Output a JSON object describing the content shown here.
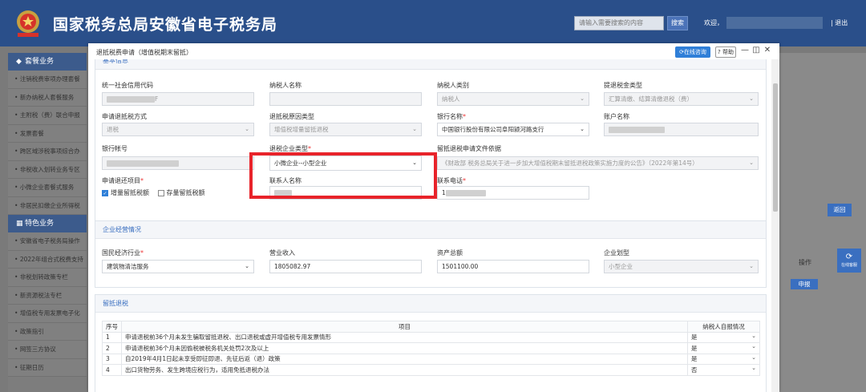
{
  "header": {
    "site_title": "国家税务总局安徽省电子税务局",
    "search_placeholder": "请输入需要搜索的内容",
    "search_button": "搜索",
    "welcome": "欢迎，",
    "logout": "| 退出"
  },
  "sidebar": {
    "section1": "套餐业务",
    "items1": [
      "注销税费审项办理套餐",
      "新办纳税人套餐服务",
      "主附税（费）联合申报",
      "发票套餐",
      "跨区域涉税事项综合办",
      "非税收入划转业务专区",
      "小微企业套餐式服务",
      "非居民扣缴企业所得税"
    ],
    "section2": "特色业务",
    "items2": [
      "安徽省电子税务局操作",
      "2022年组合式税费支持",
      "非税划转政策专栏",
      "新资源税法专栏",
      "增值税专用发票电子化",
      "政策指引",
      "网签三方协议",
      "征期日历"
    ]
  },
  "backdrop": {
    "return": "返回",
    "operation": "操作",
    "declare": "申报",
    "online": "在线客服"
  },
  "modal": {
    "title": "退抵税费申请（增值税期末留抵）",
    "online_consult": "在线咨询",
    "help": "帮助",
    "basic_section": "基本信息",
    "fields": {
      "credit_code_label": "统一社会信用代码",
      "credit_code_value": "F",
      "taxpayer_name_label": "纳税人名称",
      "taxpayer_type_label": "纳税人类别",
      "taxpayer_type_value": "纳税人",
      "refund_type_label": "提退税金类型",
      "refund_type_value": "汇算清缴、结算清缴退税（费）",
      "method_label": "申请退抵税方式",
      "method_value": "退税",
      "reason_label": "退抵税原因类型",
      "reason_value": "增值税增量留抵退税",
      "bank_name_label": "银行名称",
      "bank_name_value": "中国银行股份有限公司阜阳颍河路支行",
      "account_name_label": "账户名称",
      "account_no_label": "银行帐号",
      "enterprise_type_label": "退税企业类型",
      "enterprise_type_value": "小微企业--小型企业",
      "basis_label": "留抵退税申请文件依据",
      "basis_value": "《财政部 税务总局关于进一步加大增值税期末留抵退税政策实施力度的公告》（2022年第14号）",
      "refund_item_label": "申请退还项目",
      "refund_item_opt1": "增量留抵税额",
      "refund_item_opt2": "存量留抵税额",
      "contact_label": "联系人名称",
      "phone_label": "联系电话",
      "phone_value": "1"
    },
    "ops_section": "企业经营情况",
    "ops": {
      "industry_label": "国民经济行业",
      "industry_value": "建筑物清洁服务",
      "revenue_label": "营业收入",
      "revenue_value": "1805082.97",
      "assets_label": "资产总额",
      "assets_value": "1501100.00",
      "scale_label": "企业划型",
      "scale_value": "小型企业"
    },
    "retain_section": "留抵退税",
    "table": {
      "col_no": "序号",
      "col_item": "项目",
      "col_status": "纳税人自报情况",
      "rows": [
        {
          "no": "1",
          "item": "申请退税前36个月未发生骗取留抵退税、出口退税或虚开增值税专用发票情形",
          "status": "是"
        },
        {
          "no": "2",
          "item": "申请退税前36个月未因偷税被税务机关处罚2次及以上",
          "status": "是"
        },
        {
          "no": "3",
          "item": "自2019年4月1日起未享受即征即退、先征后返（退）政策",
          "status": "是"
        },
        {
          "no": "4",
          "item": "出口货物劳务、发生跨境应税行为，适用免抵退税办法",
          "status": "否"
        }
      ]
    }
  }
}
